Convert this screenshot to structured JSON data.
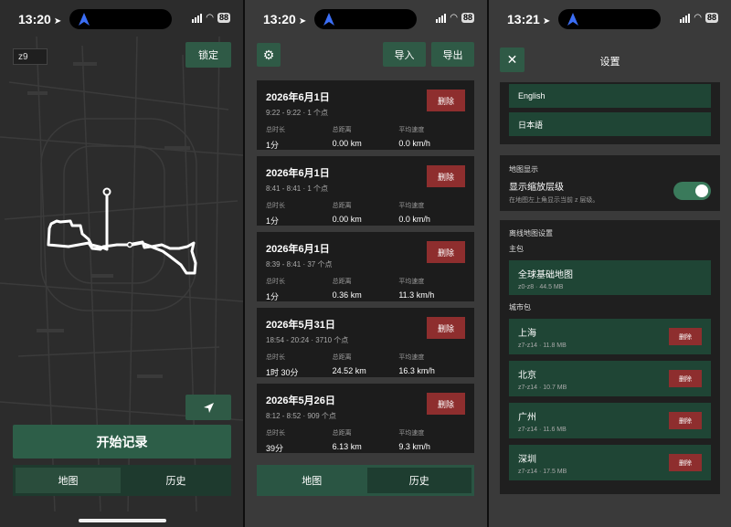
{
  "status_bars": [
    {
      "time": "13:20",
      "battery": "88"
    },
    {
      "time": "13:20",
      "battery": "88"
    },
    {
      "time": "13:21",
      "battery": "88"
    }
  ],
  "map_screen": {
    "zoom_level": "z9",
    "lock_label": "锁定",
    "start_label": "开始记录",
    "tabs": [
      "地图",
      "历史"
    ],
    "active_tab": "地图"
  },
  "history_screen": {
    "import_label": "导入",
    "export_label": "导出",
    "stat_headers": [
      "总时长",
      "总距离",
      "平均速度"
    ],
    "delete_label": "删除",
    "records": [
      {
        "date": "2026年6月1日",
        "sub": "9:22 - 9:22 · 1 个点",
        "duration": "1分",
        "distance": "0.00 km",
        "speed": "0.0 km/h"
      },
      {
        "date": "2026年6月1日",
        "sub": "8:41 - 8:41 · 1 个点",
        "duration": "1分",
        "distance": "0.00 km",
        "speed": "0.0 km/h"
      },
      {
        "date": "2026年6月1日",
        "sub": "8:39 - 8:41 · 37 个点",
        "duration": "1分",
        "distance": "0.36 km",
        "speed": "11.3 km/h"
      },
      {
        "date": "2026年5月31日",
        "sub": "18:54 - 20:24 · 3710 个点",
        "duration": "1时 30分",
        "distance": "24.52 km",
        "speed": "16.3 km/h"
      },
      {
        "date": "2026年5月26日",
        "sub": "8:12 - 8:52 · 909 个点",
        "duration": "39分",
        "distance": "6.13 km",
        "speed": "9.3 km/h"
      }
    ],
    "tabs": [
      "地图",
      "历史"
    ],
    "active_tab": "历史"
  },
  "settings_screen": {
    "title": "设置",
    "languages": [
      "English",
      "日本語"
    ],
    "display_section": "地图显示",
    "show_zoom_label": "显示缩放层级",
    "show_zoom_desc": "在地图左上角显示当前 z 层级。",
    "show_zoom_on": true,
    "offline_section": "离线地图设置",
    "main_pkg_title": "主包",
    "main_pkg": {
      "name": "全球基础地图",
      "meta": "z0-z8 · 44.5 MB"
    },
    "city_pkg_title": "城市包",
    "delete_label": "删除",
    "cities": [
      {
        "name": "上海",
        "meta": "z7-z14 · 11.8 MB"
      },
      {
        "name": "北京",
        "meta": "z7-z14 · 10.7 MB"
      },
      {
        "name": "广州",
        "meta": "z7-z14 · 11.6 MB"
      },
      {
        "name": "深圳",
        "meta": "z7-z14 · 17.5 MB"
      }
    ]
  },
  "colors": {
    "accent_green": "#2f5a46",
    "delete_red": "#8e2e2e",
    "route": "#ffffff"
  }
}
